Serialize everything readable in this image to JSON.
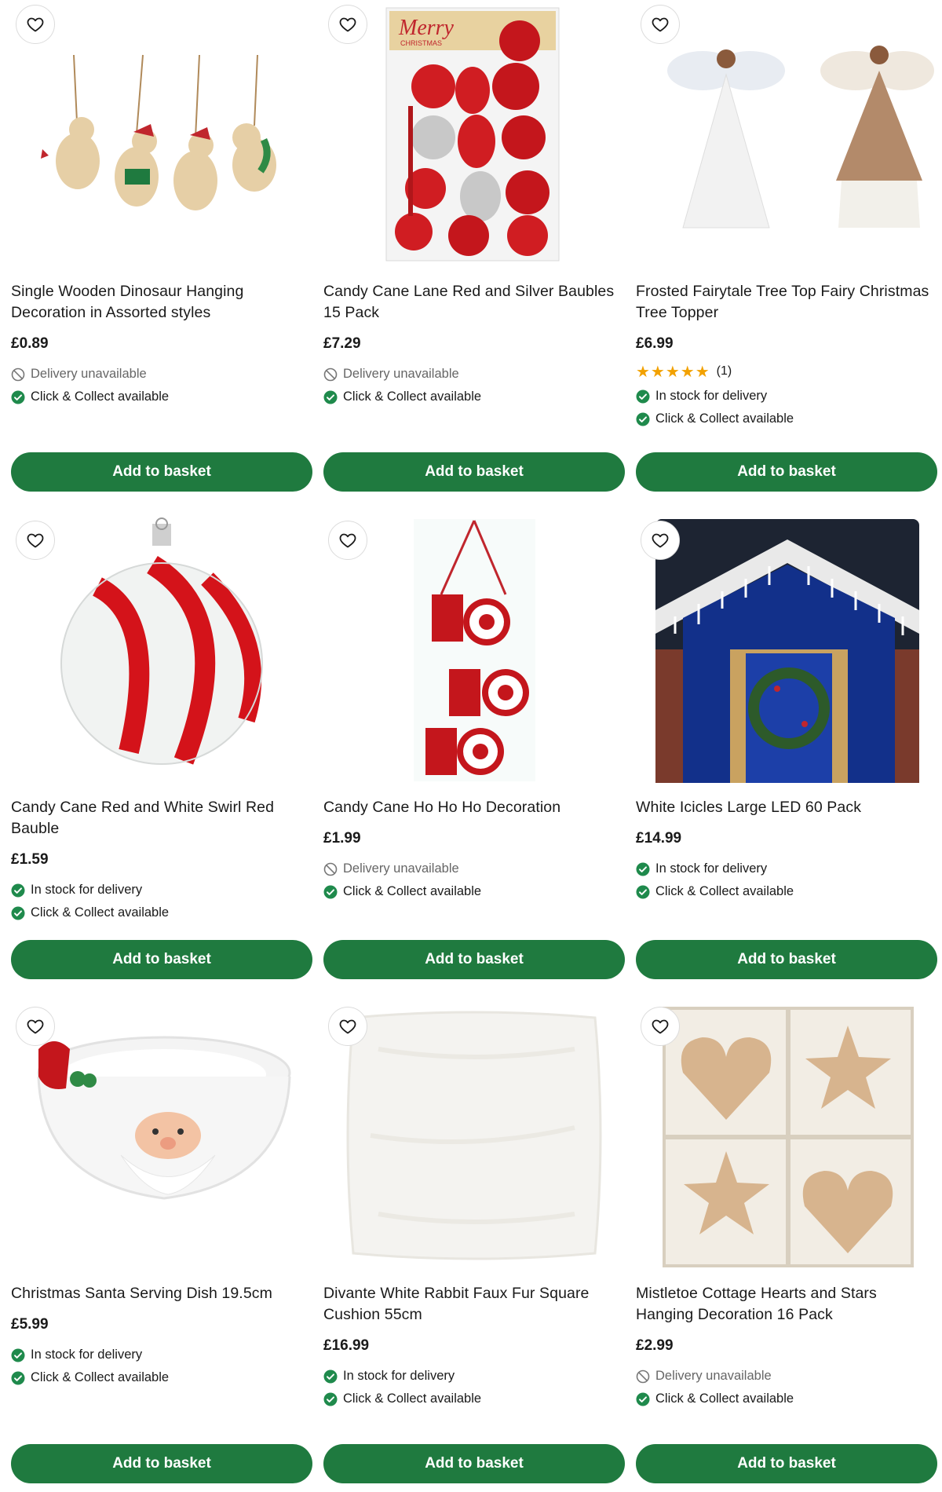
{
  "products": [
    {
      "title": "Single Wooden Dinosaur Hanging Decoration in Assorted styles",
      "price": "£0.89",
      "delivery": {
        "type": "unavailable",
        "text": "Delivery unavailable"
      },
      "collect": {
        "type": "available",
        "text": "Click & Collect available"
      },
      "button": "Add to basket"
    },
    {
      "title": "Candy Cane Lane Red and Silver Baubles 15 Pack",
      "price": "£7.29",
      "box_text": "Merry",
      "box_subtext": "CHRISTMAS",
      "delivery": {
        "type": "unavailable",
        "text": "Delivery unavailable"
      },
      "collect": {
        "type": "available",
        "text": "Click & Collect available"
      },
      "button": "Add to basket"
    },
    {
      "title": "Frosted Fairytale Tree Top Fairy Christmas Tree Topper",
      "price": "£6.99",
      "rating": {
        "stars": 5,
        "count": "(1)"
      },
      "delivery": {
        "type": "available",
        "text": "In stock for delivery"
      },
      "collect": {
        "type": "available",
        "text": "Click & Collect available"
      },
      "button": "Add to basket"
    },
    {
      "title": "Candy Cane Red and White Swirl Red Bauble",
      "price": "£1.59",
      "delivery": {
        "type": "available",
        "text": "In stock for delivery"
      },
      "collect": {
        "type": "available",
        "text": "Click & Collect available"
      },
      "button": "Add to basket"
    },
    {
      "title": "Candy Cane Ho Ho Ho Decoration",
      "price": "£1.99",
      "delivery": {
        "type": "unavailable",
        "text": "Delivery unavailable"
      },
      "collect": {
        "type": "available",
        "text": "Click & Collect available"
      },
      "button": "Add to basket"
    },
    {
      "title": "White Icicles Large LED 60 Pack",
      "price": "£14.99",
      "delivery": {
        "type": "available",
        "text": "In stock for delivery"
      },
      "collect": {
        "type": "available",
        "text": "Click & Collect available"
      },
      "button": "Add to basket"
    },
    {
      "title": "Christmas Santa Serving Dish 19.5cm",
      "price": "£5.99",
      "delivery": {
        "type": "available",
        "text": "In stock for delivery"
      },
      "collect": {
        "type": "available",
        "text": "Click & Collect available"
      },
      "button": "Add to basket"
    },
    {
      "title": "Divante White Rabbit Faux Fur Square Cushion 55cm",
      "price": "£16.99",
      "delivery": {
        "type": "available",
        "text": "In stock for delivery"
      },
      "collect": {
        "type": "available",
        "text": "Click & Collect available"
      },
      "button": "Add to basket"
    },
    {
      "title": "Mistletoe Cottage Hearts and Stars Hanging Decoration 16 Pack",
      "price": "£2.99",
      "delivery": {
        "type": "unavailable",
        "text": "Delivery unavailable"
      },
      "collect": {
        "type": "available",
        "text": "Click & Collect available"
      },
      "button": "Add to basket"
    }
  ],
  "colors": {
    "brand_green": "#1f7a3f",
    "status_green": "#1f8a4c",
    "star": "#f2a100",
    "muted": "#666666"
  },
  "icons": {
    "wishlist": "heart-outline-icon",
    "available": "check-circle-icon",
    "unavailable": "prohibited-icon"
  }
}
